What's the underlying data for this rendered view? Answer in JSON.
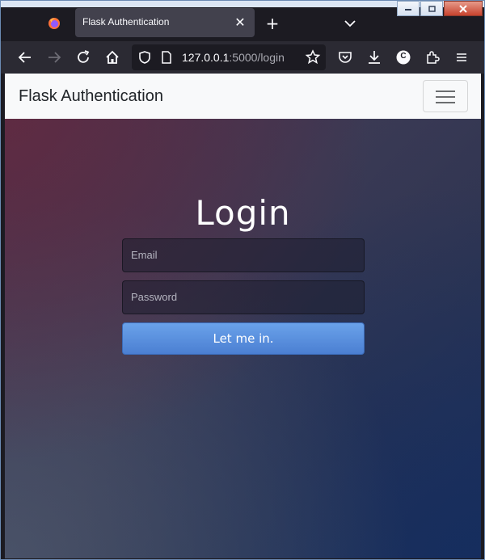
{
  "browser": {
    "tab_title": "Flask Authentication",
    "url_host": "127.0.0.1",
    "url_rest": ":5000/login",
    "accent_color": "#42414d",
    "profile_initial": "C"
  },
  "site": {
    "brand": "Flask Authentication"
  },
  "login": {
    "title": "Login",
    "email_placeholder": "Email",
    "password_placeholder": "Password",
    "submit_label": "Let me in.",
    "button_color": "#5a8ede"
  }
}
